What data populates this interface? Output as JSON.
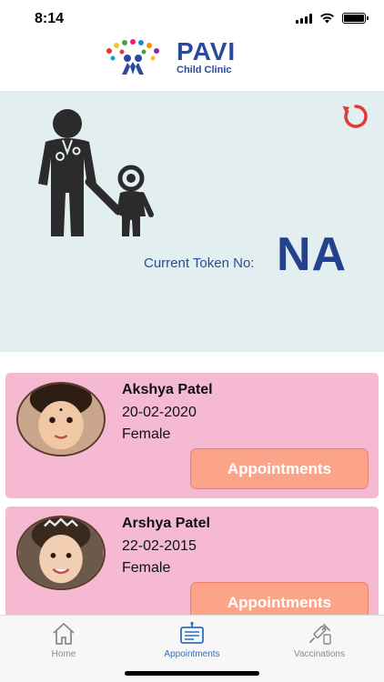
{
  "status_bar": {
    "time": "8:14",
    "icons": [
      "cellular-signal-icon",
      "wifi-icon",
      "battery-icon"
    ]
  },
  "header": {
    "logo_title": "PAVI",
    "logo_subtitle": "Child Clinic"
  },
  "hero": {
    "token_label": "Current Token No:",
    "token_value": "NA",
    "refresh_icon": "refresh-icon",
    "background_color": "#e2eef0",
    "token_color": "#23418c"
  },
  "patients": [
    {
      "name": "Akshya Patel",
      "dob": "20-02-2020",
      "gender": "Female",
      "button_label": "Appointments"
    },
    {
      "name": "Arshya Patel",
      "dob": "22-02-2015",
      "gender": "Female",
      "button_label": "Appointments"
    }
  ],
  "card_color": "#f6b9d2",
  "button_color": "#fba48a",
  "tabs": [
    {
      "label": "Home",
      "icon": "home-icon",
      "active": false
    },
    {
      "label": "Appointments",
      "icon": "appointments-icon",
      "active": true
    },
    {
      "label": "Vaccinations",
      "icon": "vaccination-icon",
      "active": false
    }
  ],
  "accent_color": "#2c6fc2"
}
